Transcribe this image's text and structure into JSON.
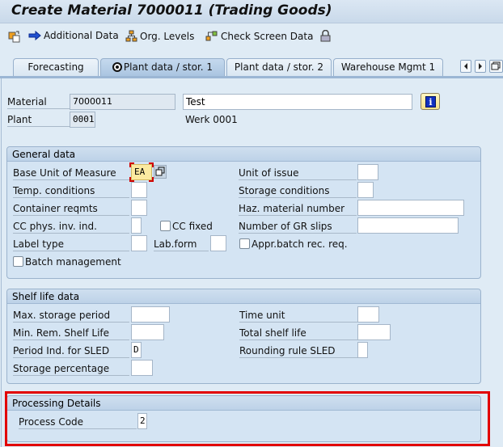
{
  "window": {
    "title": "Create Material 7000011 (Trading Goods)"
  },
  "toolbar": {
    "items": [
      {
        "icon": "other-view-icon",
        "label": ""
      },
      {
        "icon": "arrow-right-icon",
        "label": "Additional Data"
      },
      {
        "icon": "org-levels-icon",
        "label": "Org. Levels"
      },
      {
        "icon": "check-screen-icon",
        "label": "Check Screen Data"
      },
      {
        "icon": "lock-icon",
        "label": ""
      }
    ]
  },
  "tabs": {
    "items": [
      {
        "label": "Forecasting",
        "active": false
      },
      {
        "label": "Plant data / stor. 1",
        "active": true
      },
      {
        "label": "Plant data / stor. 2",
        "active": false
      },
      {
        "label": "Warehouse Mgmt 1",
        "active": false
      }
    ],
    "nav": [
      "scroll-left-icon",
      "scroll-right-icon",
      "tab-list-icon"
    ]
  },
  "header": {
    "material_label": "Material",
    "material_value": "7000011",
    "description_value": "Test",
    "plant_label": "Plant",
    "plant_value": "0001",
    "plant_name": "Werk 0001"
  },
  "general_data": {
    "title": "General data",
    "base_uom_label": "Base Unit of Measure",
    "base_uom_value": "EA",
    "temp_cond_label": "Temp. conditions",
    "container_label": "Container reqmts",
    "cc_phys_label": "CC phys. inv. ind.",
    "cc_fixed_label": "CC fixed",
    "label_type_label": "Label type",
    "lab_form_label": "Lab.form",
    "batch_mgmt_label": "Batch management",
    "unit_issue_label": "Unit of issue",
    "storage_cond_label": "Storage conditions",
    "haz_label": "Haz. material number",
    "gr_slips_label": "Number of GR slips",
    "appr_batch_label": "Appr.batch rec. req."
  },
  "shelf_life": {
    "title": "Shelf life data",
    "max_storage_label": "Max. storage period",
    "min_rem_label": "Min. Rem. Shelf Life",
    "period_ind_label": "Period Ind. for SLED",
    "period_ind_value": "D",
    "storage_pct_label": "Storage percentage",
    "time_unit_label": "Time unit",
    "total_shelf_label": "Total shelf life",
    "rounding_label": "Rounding rule SLED"
  },
  "processing": {
    "title": "Processing Details",
    "process_code_label": "Process Code",
    "process_code_value": "2"
  },
  "colors": {
    "highlight": "#e20000",
    "background": "#dfebf5"
  }
}
